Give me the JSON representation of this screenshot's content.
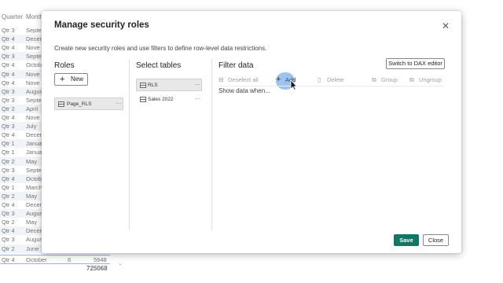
{
  "background": {
    "headers": {
      "quarter": "Quarter",
      "month": "Month"
    },
    "rows": [
      [
        "Qtr 3",
        "Septe"
      ],
      [
        "Qtr 4",
        "Decen"
      ],
      [
        "Qtr 4",
        "Nove"
      ],
      [
        "Qtr 3",
        "Septe"
      ],
      [
        "Qtr 4",
        "Octob"
      ],
      [
        "Qtr 4",
        "Nove"
      ],
      [
        "Qtr 4",
        "Nove"
      ],
      [
        "Qtr 3",
        "Augus"
      ],
      [
        "Qtr 3",
        "Septe"
      ],
      [
        "Qtr 2",
        "April"
      ],
      [
        "Qtr 4",
        "Nove"
      ],
      [
        "Qtr 3",
        "July"
      ],
      [
        "Qtr 4",
        "Decen"
      ],
      [
        "Qtr 1",
        "Januar"
      ],
      [
        "Qtr 1",
        "Januar"
      ],
      [
        "Qtr 2",
        "May"
      ],
      [
        "Qtr 3",
        "Septe"
      ],
      [
        "Qtr 4",
        "Octob"
      ],
      [
        "Qtr 1",
        "March"
      ],
      [
        "Qtr 2",
        "May"
      ],
      [
        "Qtr 4",
        "Decen"
      ],
      [
        "Qtr 3",
        "Augus"
      ],
      [
        "Qtr 2",
        "May"
      ],
      [
        "Qtr 4",
        "Decen"
      ],
      [
        "Qtr 3",
        "Augus"
      ],
      [
        "Qtr 2",
        "June"
      ]
    ],
    "selected_row": {
      "quarter": "Qtr 4",
      "month": "October",
      "num": "6",
      "value": "5948"
    },
    "total": "725068"
  },
  "dialog": {
    "title": "Manage security roles",
    "description": "Create new security roles and use filters to define row-level data restrictions.",
    "close_glyph": "✕"
  },
  "roles": {
    "heading": "Roles",
    "new_label": "New",
    "items": [
      {
        "label": "Page_RLS"
      }
    ]
  },
  "tables": {
    "heading": "Select tables",
    "items": [
      {
        "label": "RLS"
      },
      {
        "label": "Sales 2022"
      }
    ]
  },
  "filter": {
    "heading": "Filter data",
    "switch_label": "Switch to DAX editor",
    "toolbar": {
      "deselect_all": "Deselect all",
      "add": "Add",
      "delete": "Delete",
      "group": "Group",
      "ungroup": "Ungroup"
    },
    "show_data": "Show data when..."
  },
  "footer": {
    "save_label": "Save",
    "close_label": "Close"
  },
  "more_glyph": "···",
  "colors": {
    "save": "#117865",
    "highlight": "#4c92e6",
    "selected_row_border": "#5b8ed6"
  }
}
